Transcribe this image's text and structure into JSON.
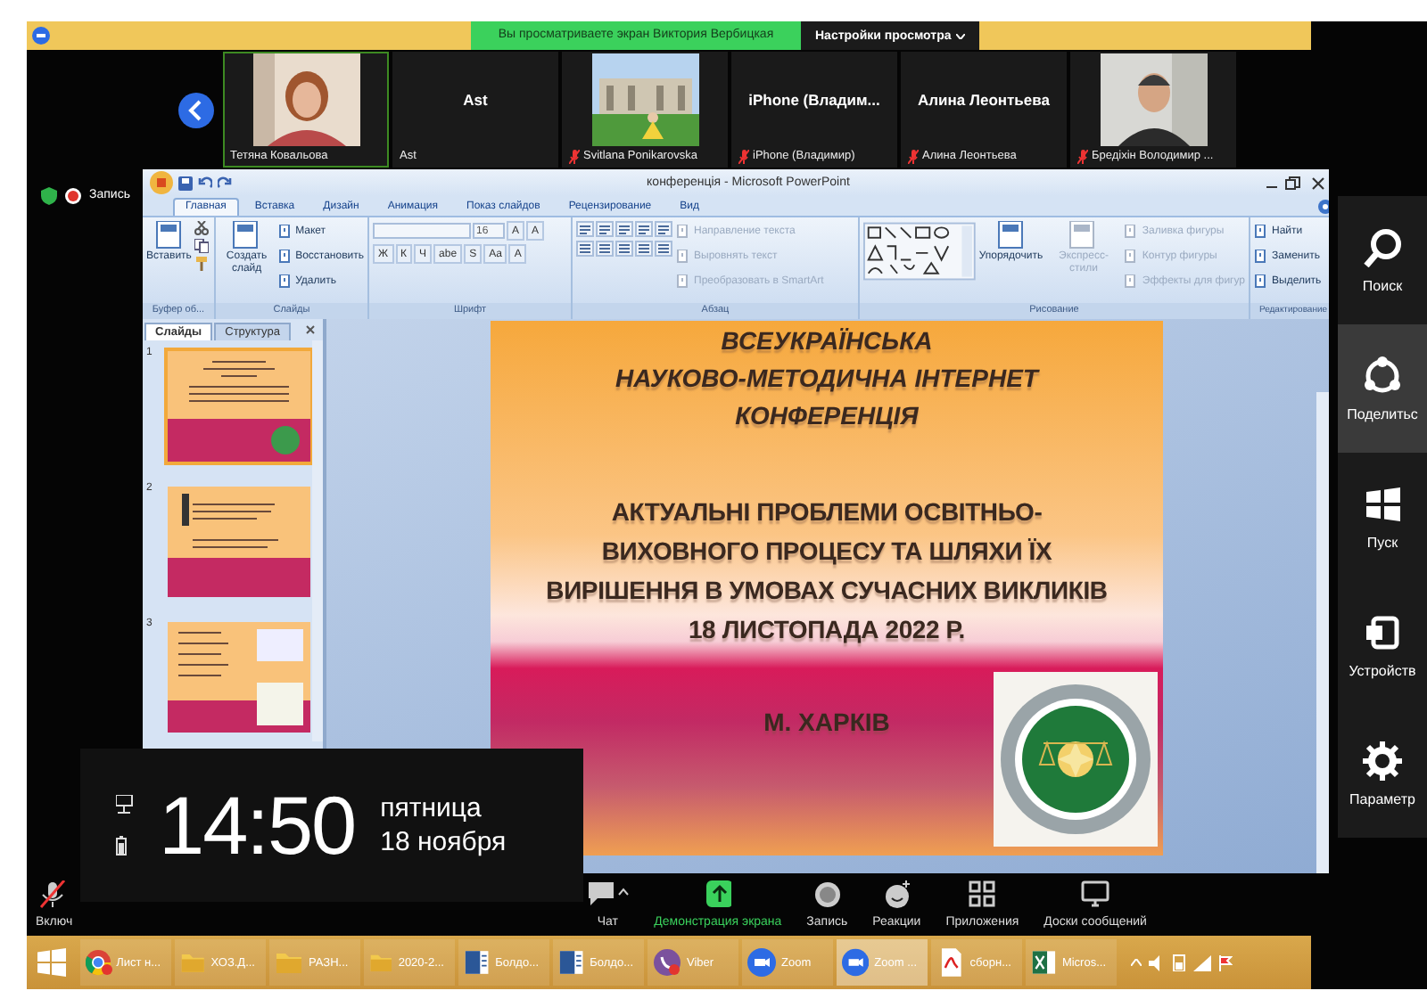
{
  "banner": {
    "message": "Вы просматриваете экран Виктория Вербицкая",
    "settings_button": "Настройки просмотра"
  },
  "participants": [
    {
      "kind": "video",
      "label": "Тетяна Ковальова",
      "speaking": true,
      "muted": false
    },
    {
      "kind": "name",
      "display_name": "Ast",
      "label": "Ast",
      "speaking": false,
      "muted": false
    },
    {
      "kind": "video",
      "label": "Svitlana Ponikarovska",
      "speaking": false,
      "muted": true
    },
    {
      "kind": "name",
      "display_name": "iPhone  (Владим...",
      "label": "iPhone (Владимир)",
      "speaking": false,
      "muted": true
    },
    {
      "kind": "name",
      "display_name": "Алина Леонтьева",
      "label": "Алина Леонтьева",
      "speaking": false,
      "muted": true
    },
    {
      "kind": "video",
      "label": "Бредіхін Володимир ...",
      "speaking": false,
      "muted": true
    }
  ],
  "recording": {
    "label": "Запись"
  },
  "powerpoint": {
    "title": "конференція - Microsoft PowerPoint",
    "tabs": [
      {
        "label": "Главная",
        "selected": true
      },
      {
        "label": "Вставка",
        "selected": false
      },
      {
        "label": "Дизайн",
        "selected": false
      },
      {
        "label": "Анимация",
        "selected": false
      },
      {
        "label": "Показ слайдов",
        "selected": false
      },
      {
        "label": "Рецензирование",
        "selected": false
      },
      {
        "label": "Вид",
        "selected": false
      }
    ],
    "ribbon": [
      {
        "kind": "clipboard",
        "label": "Буфер об...",
        "commands": [
          {
            "kind": "large",
            "label": "Вставить",
            "disabled": false
          }
        ]
      },
      {
        "kind": "slides",
        "label": "Слайды",
        "commands": [
          {
            "kind": "large",
            "label": "Создать слайд",
            "disabled": false
          },
          {
            "kind": "small",
            "label": "Макет",
            "disabled": false
          },
          {
            "kind": "small",
            "label": "Восстановить",
            "disabled": false
          },
          {
            "kind": "small",
            "label": "Удалить",
            "disabled": false
          }
        ]
      },
      {
        "kind": "font",
        "label": "Шрифт",
        "font_size": "16",
        "size_buttons": [
          "A",
          "A"
        ],
        "format_buttons": [
          "Ж",
          "К",
          "Ч",
          "abe",
          "S",
          "Aa",
          "A"
        ]
      },
      {
        "kind": "paragraph",
        "label": "Абзац",
        "commands": [
          {
            "kind": "small",
            "label": "Направление текста",
            "disabled": true
          },
          {
            "kind": "small",
            "label": "Выровнять текст",
            "disabled": true
          },
          {
            "kind": "small",
            "label": "Преобразовать в SmartArt",
            "disabled": true
          }
        ]
      },
      {
        "kind": "drawing",
        "label": "Рисование",
        "commands": [
          {
            "kind": "large",
            "label": "Упорядочить",
            "disabled": false
          },
          {
            "kind": "large",
            "label": "Экспресс-стили",
            "disabled": true
          },
          {
            "kind": "small",
            "label": "Заливка фигуры",
            "disabled": true
          },
          {
            "kind": "small",
            "label": "Контур фигуры",
            "disabled": true
          },
          {
            "kind": "small",
            "label": "Эффекты для фигур",
            "disabled": true
          }
        ]
      },
      {
        "kind": "editing",
        "label": "Редактирование",
        "commands": [
          {
            "kind": "small",
            "label": "Найти",
            "disabled": false
          },
          {
            "kind": "small",
            "label": "Заменить",
            "disabled": false
          },
          {
            "kind": "small",
            "label": "Выделить",
            "disabled": false
          }
        ]
      }
    ],
    "panel_tabs": [
      {
        "label": "Слайды",
        "selected": true
      },
      {
        "label": "Структура",
        "selected": false
      }
    ],
    "thumbnails": [
      {
        "number": "1",
        "selected": true
      },
      {
        "number": "2",
        "selected": false
      },
      {
        "number": "3",
        "selected": false
      }
    ],
    "slide": {
      "heading_lines": [
        "ВСЕУКРАЇНСЬКА",
        "НАУКОВО-МЕТОДИЧНА ІНТЕРНЕТ",
        "КОНФЕРЕНЦІЯ"
      ],
      "title_lines": [
        "АКТУАЛЬНІ ПРОБЛЕМИ ОСВІТНЬО-",
        "ВИХОВНОГО ПРОЦЕСУ  ТА ШЛЯХИ ЇХ",
        "ВИРІШЕННЯ В УМОВАХ СУЧАСНИХ ВИКЛИКІВ",
        "18 ЛИСТОПАДА 2022 Р."
      ],
      "city": "М. ХАРКІВ"
    }
  },
  "clock": {
    "time": "14:50",
    "day": "пятница",
    "date": "18 ноября"
  },
  "meeting_controls": [
    {
      "kind": "audio",
      "label": "Включ"
    },
    {
      "kind": "chat",
      "label": "Чат"
    },
    {
      "kind": "share",
      "label": "Демонстрация экрана"
    },
    {
      "kind": "record",
      "label": "Запись"
    },
    {
      "kind": "reactions",
      "label": "Реакции"
    },
    {
      "kind": "apps",
      "label": "Приложения"
    },
    {
      "kind": "whiteboard",
      "label": "Доски сообщений"
    }
  ],
  "charms": [
    {
      "kind": "search",
      "label": "Поиск",
      "selected": false
    },
    {
      "kind": "share",
      "label": "Поделитьс",
      "selected": true
    },
    {
      "kind": "start",
      "label": "Пуск",
      "selected": false
    },
    {
      "kind": "devices",
      "label": "Устройств",
      "selected": false
    },
    {
      "kind": "settings",
      "label": "Параметр",
      "selected": false
    }
  ],
  "taskbar": [
    {
      "kind": "chrome",
      "label": "Лист н...",
      "badge": true,
      "selected": false
    },
    {
      "kind": "folder",
      "label": "ХОЗ.Д...",
      "badge": false,
      "selected": false
    },
    {
      "kind": "folder",
      "label": "РАЗН...",
      "badge": false,
      "selected": false
    },
    {
      "kind": "folder",
      "label": "2020-2...",
      "badge": false,
      "selected": false
    },
    {
      "kind": "word",
      "label": "Болдо...",
      "badge": false,
      "selected": false
    },
    {
      "kind": "word",
      "label": "Болдо...",
      "badge": false,
      "selected": false
    },
    {
      "kind": "viber",
      "label": "Viber",
      "badge": true,
      "selected": false
    },
    {
      "kind": "zoom",
      "label": "Zoom",
      "badge": false,
      "selected": false
    },
    {
      "kind": "zoom",
      "label": "Zoom ...",
      "badge": false,
      "selected": true
    },
    {
      "kind": "pdf",
      "label": "сборн...",
      "badge": false,
      "selected": false
    },
    {
      "kind": "excel",
      "label": "Micros...",
      "badge": false,
      "selected": false
    }
  ]
}
